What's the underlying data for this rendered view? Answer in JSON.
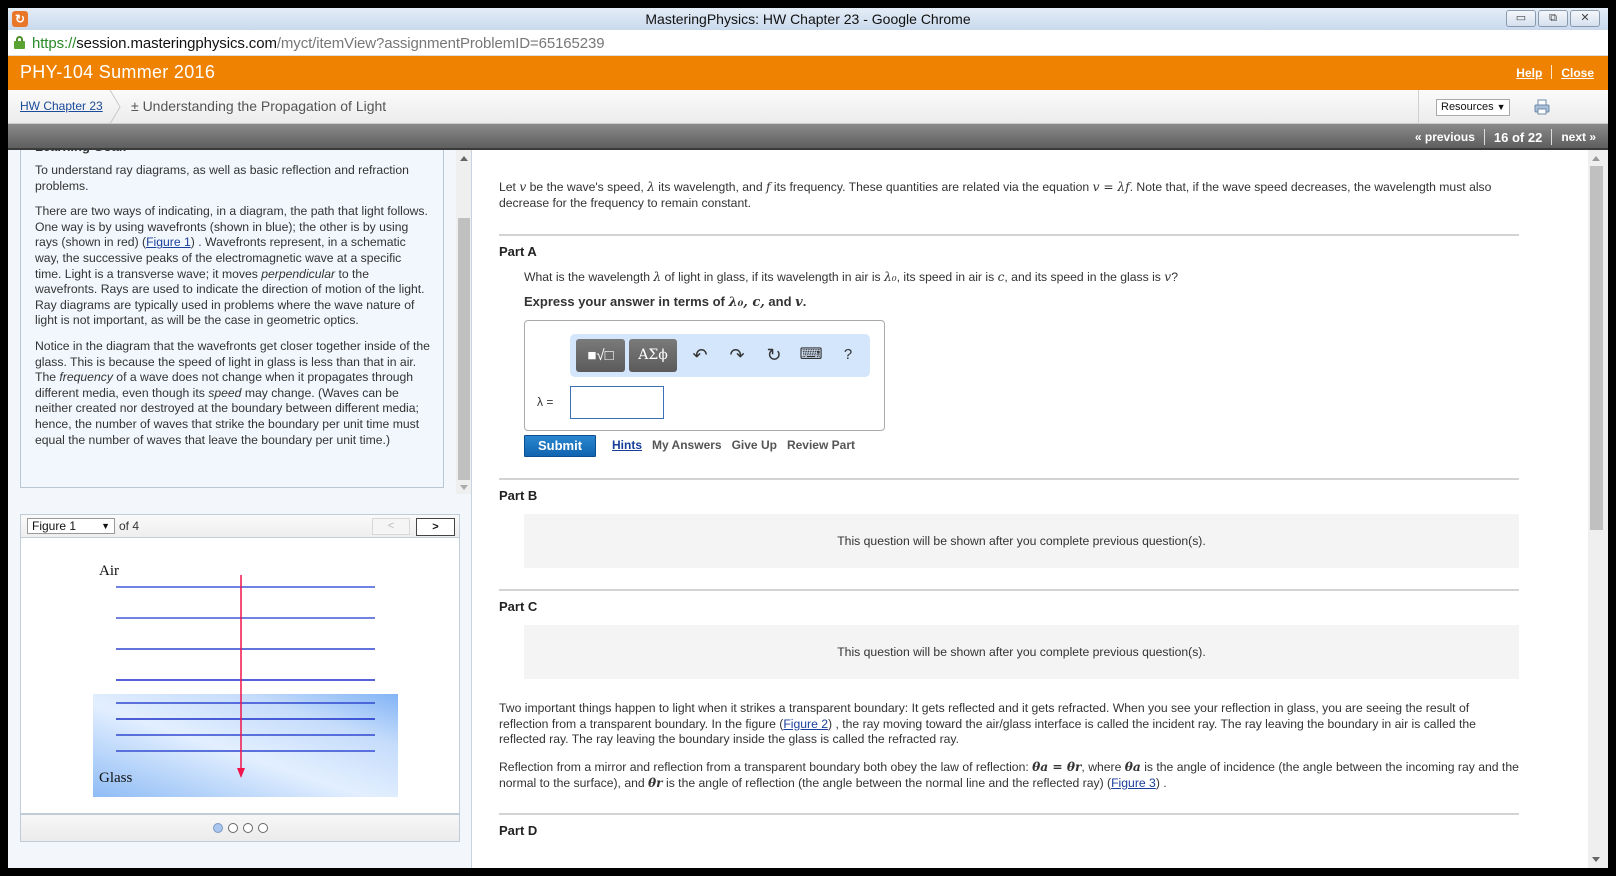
{
  "browser": {
    "window_title": "MasteringPhysics: HW Chapter 23 - Google Chrome",
    "url_scheme": "https://",
    "url_host": "session.masteringphysics.com",
    "url_path": "/myct/itemView?assignmentProblemID=65165239",
    "buttons": {
      "minimize": "▭",
      "restore": "⧉",
      "close": "✕"
    }
  },
  "header": {
    "course": "PHY-104 Summer 2016",
    "help": "Help",
    "close": "Close",
    "accent": "#ef8200"
  },
  "breadcrumb": {
    "assignment": "HW Chapter 23",
    "current": "± Understanding the Propagation of Light",
    "resources": "Resources",
    "resources_arrow": "▼"
  },
  "nav": {
    "previous": "« previous",
    "position": "16 of 22",
    "next": "next »"
  },
  "learning_goal": {
    "title": "Learning Goal:",
    "p1": "To understand ray diagrams, as well as basic reflection and refraction problems.",
    "p2_a": "There are two ways of indicating, in a diagram, the path that light follows. One way is by using wavefronts (shown in blue); the other is by using rays (shown in red) (",
    "p2_link": "Figure 1",
    "p2_b": ") . Wavefronts represent, in a schematic way, the successive peaks of the electromagnetic wave at a specific time. Light is a transverse wave; it moves ",
    "p2_em": "perpendicular",
    "p2_c": " to the wavefronts. Rays are used to indicate the direction of motion of the light. Ray diagrams are typically used in problems where the wave nature of light is not important, as will be the case in geometric optics.",
    "p3_a": "Notice in the diagram that the wavefronts get closer together inside of the glass. This is because the speed of light in glass is less than that in air. The ",
    "p3_em1": "frequency",
    "p3_b": " of a wave does not change when it propagates through different media, even though its ",
    "p3_em2": "speed",
    "p3_c": " may change. (Waves can be neither created nor destroyed at the boundary between different media; hence, the number of waves that strike the boundary per unit time must equal the number of waves that leave the boundary per unit time.)"
  },
  "figure": {
    "selected": "Figure 1",
    "select_arrow": "▼",
    "of_label": "of 4",
    "prev": "<",
    "next": ">",
    "label_air": "Air",
    "label_glass": "Glass",
    "total": 4,
    "current": 1
  },
  "intro": {
    "a": "Let ",
    "v": "v",
    "b": " be the wave's speed, ",
    "lambda": "λ",
    "c": " its wavelength, and ",
    "f": "f",
    "d": " its frequency. These quantities are related via the equation ",
    "eq": "v = λf",
    "e": ". Note that, if the wave speed decreases, the wavelength must also decrease for the frequency to remain constant."
  },
  "part_a": {
    "title": "Part A",
    "q_a": "What is the wavelength ",
    "q_lambda": "λ",
    "q_b": " of light in glass, if its wavelength in air is ",
    "q_lambda0": "λ₀",
    "q_c": ", its speed in air is ",
    "q_cvar": "c",
    "q_d": ", and its speed in the glass is ",
    "q_v": "v",
    "q_e": "?",
    "express_a": "Express your answer in terms of ",
    "express_vars": "λ₀, c,",
    "express_b": " and ",
    "express_v": "v",
    "express_c": ".",
    "toolbar": {
      "templates": "■√□",
      "greek": "ΑΣϕ",
      "undo": "↶",
      "redo": "↷",
      "reset": "↻",
      "keyboard": "⌨",
      "help": "?"
    },
    "answer_label": "λ =",
    "answer_value": "",
    "submit": "Submit",
    "hints": "Hints",
    "my_answers": "My Answers",
    "give_up": "Give Up",
    "review_part": "Review Part"
  },
  "part_b": {
    "title": "Part B",
    "locked": "This question will be shown after you complete previous question(s)."
  },
  "part_c": {
    "title": "Part C",
    "locked": "This question will be shown after you complete previous question(s)."
  },
  "para1": {
    "a": "Two important things happen to light when it strikes a transparent boundary: It gets reflected and it gets refracted. When you see your reflection in glass, you are seeing the result of reflection from a transparent boundary. In the figure (",
    "link": "Figure 2",
    "b": ") , the ray moving toward the air/glass interface is called the incident ray. The ray leaving the boundary in air is called the reflected ray. The ray leaving the boundary inside the glass is called the refracted ray."
  },
  "para2": {
    "a": "Reflection from a mirror and reflection from a transparent boundary both obey the law of reflection: ",
    "eq": "θa = θr",
    "b": ", where ",
    "theta_a": "θa",
    "c": " is the angle of incidence (the angle between the incoming ray and the normal to the surface), and ",
    "theta_r": "θr",
    "d": " is the angle of reflection (the angle between the normal line and the reflected ray) (",
    "link": "Figure 3",
    "e": ") ."
  },
  "part_d": {
    "title": "Part D"
  }
}
